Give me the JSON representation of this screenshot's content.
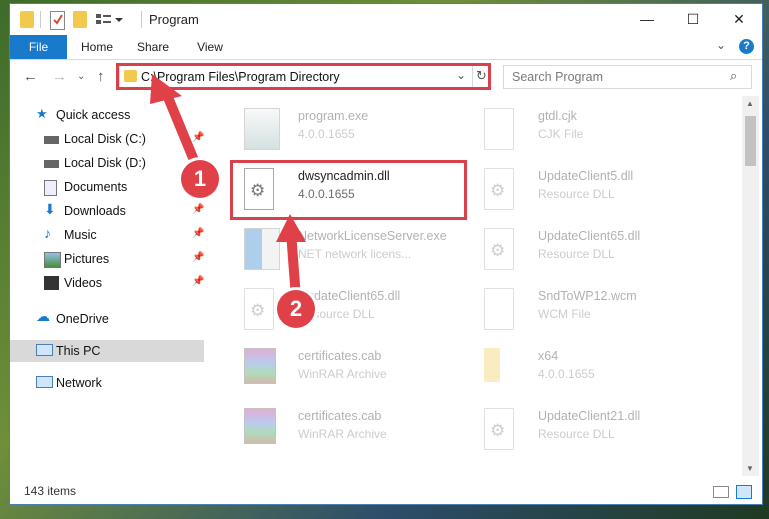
{
  "window": {
    "title": "Program"
  },
  "ribbon": {
    "tabs": [
      "File",
      "Home",
      "Share",
      "View"
    ]
  },
  "nav": {
    "address": "C:\\Program Files\\Program Directory",
    "search_placeholder": "Search Program"
  },
  "sidebar": {
    "items": [
      {
        "label": "Quick access",
        "icon": "star-icon",
        "pinned": false
      },
      {
        "label": "Local Disk (C:)",
        "icon": "drive-icon",
        "pinned": true
      },
      {
        "label": "Local Disk (D:)",
        "icon": "drive-icon",
        "pinned": false
      },
      {
        "label": "Documents",
        "icon": "documents-icon",
        "pinned": true
      },
      {
        "label": "Downloads",
        "icon": "download-icon",
        "pinned": true
      },
      {
        "label": "Music",
        "icon": "music-icon",
        "pinned": true
      },
      {
        "label": "Pictures",
        "icon": "pictures-icon",
        "pinned": true
      },
      {
        "label": "Videos",
        "icon": "videos-icon",
        "pinned": true
      },
      {
        "label": "OneDrive",
        "icon": "cloud-icon",
        "pinned": false
      },
      {
        "label": "This PC",
        "icon": "computer-icon",
        "pinned": false,
        "selected": true
      },
      {
        "label": "Network",
        "icon": "network-icon",
        "pinned": false
      }
    ]
  },
  "files": [
    {
      "name": "program.exe",
      "sub": "4.0.0.1655",
      "type": "exe"
    },
    {
      "name": "gtdl.cjk",
      "sub": "CJK File",
      "type": "doc"
    },
    {
      "name": "dwsyncadmin.dll",
      "sub": "4.0.0.1655",
      "type": "dll",
      "highlighted": true
    },
    {
      "name": "UpdateClient5.dll",
      "sub": "Resource DLL",
      "type": "dll"
    },
    {
      "name": "NetworkLicenseServer.exe",
      "sub": "NET network licens...",
      "type": "exe"
    },
    {
      "name": "UpdateClient65.dll",
      "sub": "Resource DLL",
      "type": "dll"
    },
    {
      "name": "UpdateClient65.dll",
      "sub": "Resource DLL",
      "type": "dll"
    },
    {
      "name": "SndToWP12.wcm",
      "sub": "WCM File",
      "type": "doc"
    },
    {
      "name": "certificates.cab",
      "sub": "WinRAR Archive",
      "type": "rar"
    },
    {
      "name": "x64",
      "sub": "4.0.0.1655",
      "type": "folder"
    },
    {
      "name": "certificates.cab",
      "sub": "WinRAR Archive",
      "type": "rar"
    },
    {
      "name": "UpdateClient21.dll",
      "sub": "Resource DLL",
      "type": "dll"
    }
  ],
  "status": {
    "items_count": "143 items"
  },
  "annotations": {
    "step1": "1",
    "step2": "2",
    "color": "#e04047"
  }
}
